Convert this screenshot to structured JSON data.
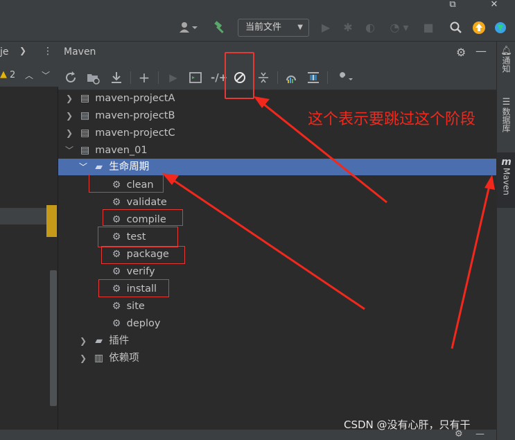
{
  "window": {
    "restore_glyph": "⧉",
    "close_glyph": "✕"
  },
  "toolbar": {
    "run_config": "当前文件",
    "icons": [
      "user-icon",
      "build-hammer-icon",
      "run-icon",
      "debug-icon",
      "coverage-icon",
      "profile-icon",
      "stop-icon",
      "search-icon",
      "update-icon",
      "plugin-icon"
    ]
  },
  "left_panel": {
    "header_text": "je",
    "problems_count": "2"
  },
  "maven": {
    "title": "Maven",
    "tree": {
      "projects": [
        {
          "label": "maven-projectA"
        },
        {
          "label": "maven-projectB"
        },
        {
          "label": "maven-projectC"
        },
        {
          "label": "maven_01"
        }
      ],
      "lifecycle_label": "生命周期",
      "lifecycle_phases": [
        "clean",
        "validate",
        "compile",
        "test",
        "package",
        "verify",
        "install",
        "site",
        "deploy"
      ],
      "plugins_label": "插件",
      "dependencies_label": "依赖项"
    }
  },
  "right_strip": {
    "notifications": "通知",
    "database": "数据库",
    "maven": "Maven"
  },
  "annotation": {
    "note": "这个表示要跳过这个阶段",
    "watermark": "CSDN @没有心肝，只有干"
  },
  "colors": {
    "selection": "#4b6eaf",
    "annotation_red": "#e53935",
    "accent_yellow": "#c59a19"
  }
}
